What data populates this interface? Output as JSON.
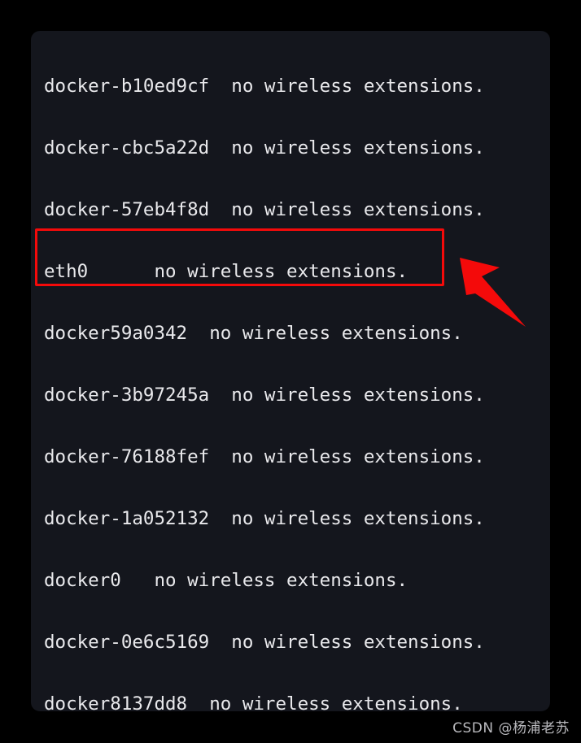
{
  "window": {
    "kind": "terminal-screenshot",
    "background_color": "#000000",
    "panel_color": "#14161d",
    "text_color": "#e9e9ec"
  },
  "terminal": {
    "command_output_type": "iwconfig",
    "lines": [
      {
        "iface": "docker-b10ed9cf",
        "gap": "  ",
        "message": "no wireless extensions."
      },
      {
        "iface": "docker-cbc5a22d",
        "gap": "  ",
        "message": "no wireless extensions."
      },
      {
        "iface": "docker-57eb4f8d",
        "gap": "  ",
        "message": "no wireless extensions."
      },
      {
        "iface": "eth0",
        "gap": "      ",
        "message": "no wireless extensions."
      },
      {
        "iface": "docker59a0342",
        "gap": "  ",
        "message": "no wireless extensions."
      },
      {
        "iface": "docker-3b97245a",
        "gap": "  ",
        "message": "no wireless extensions."
      },
      {
        "iface": "docker-76188fef",
        "gap": "  ",
        "message": "no wireless extensions."
      },
      {
        "iface": "docker-1a052132",
        "gap": "  ",
        "message": "no wireless extensions."
      },
      {
        "iface": "docker0",
        "gap": "   ",
        "message": "no wireless extensions."
      },
      {
        "iface": "docker-0e6c5169",
        "gap": "  ",
        "message": "no wireless extensions."
      },
      {
        "iface": "docker8137dd8",
        "gap": "  ",
        "message": "no wireless extensions."
      }
    ]
  },
  "annotations": {
    "highlight": {
      "target_line_index": 3,
      "target_text": "eth0      no wireless extensions.",
      "color": "#f40a0a"
    },
    "arrow": {
      "color": "#f40a0a",
      "points_to": "eth0"
    }
  },
  "watermark": {
    "text": "CSDN @杨浦老苏"
  }
}
